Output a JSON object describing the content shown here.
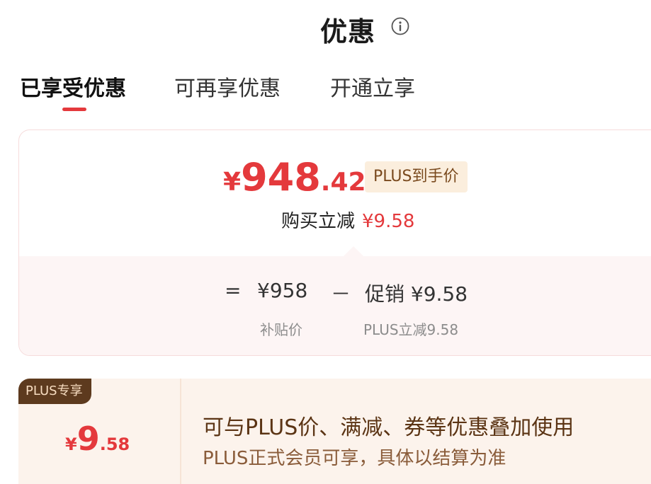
{
  "header": {
    "title": "优惠",
    "info_icon": "info-icon"
  },
  "tabs": [
    {
      "label": "已享受优惠",
      "active": true
    },
    {
      "label": "可再享优惠",
      "active": false
    },
    {
      "label": "开通立享",
      "active": false
    }
  ],
  "price_card": {
    "currency": "¥",
    "price_int": "948",
    "price_dec": ".42",
    "tag": "PLUS到手价",
    "buy_label": "购买立减",
    "buy_amount": "¥9.58",
    "calc": {
      "equals": "=",
      "base_price": "¥958",
      "minus": "－",
      "promo": "促销 ¥9.58",
      "base_label": "补贴价",
      "promo_label": "PLUS立减9.58"
    }
  },
  "plus_card": {
    "badge": "PLUS专享",
    "currency": "¥",
    "amount_int": "9",
    "amount_dec": ".58",
    "desc_main": "可与PLUS价、满减、券等优惠叠加使用",
    "desc_sub": "PLUS正式会员可享，具体以结算为准"
  },
  "colors": {
    "accent_red": "#e4393c",
    "plus_brown": "#5d3a1e",
    "tag_bg": "#fbeedd"
  }
}
